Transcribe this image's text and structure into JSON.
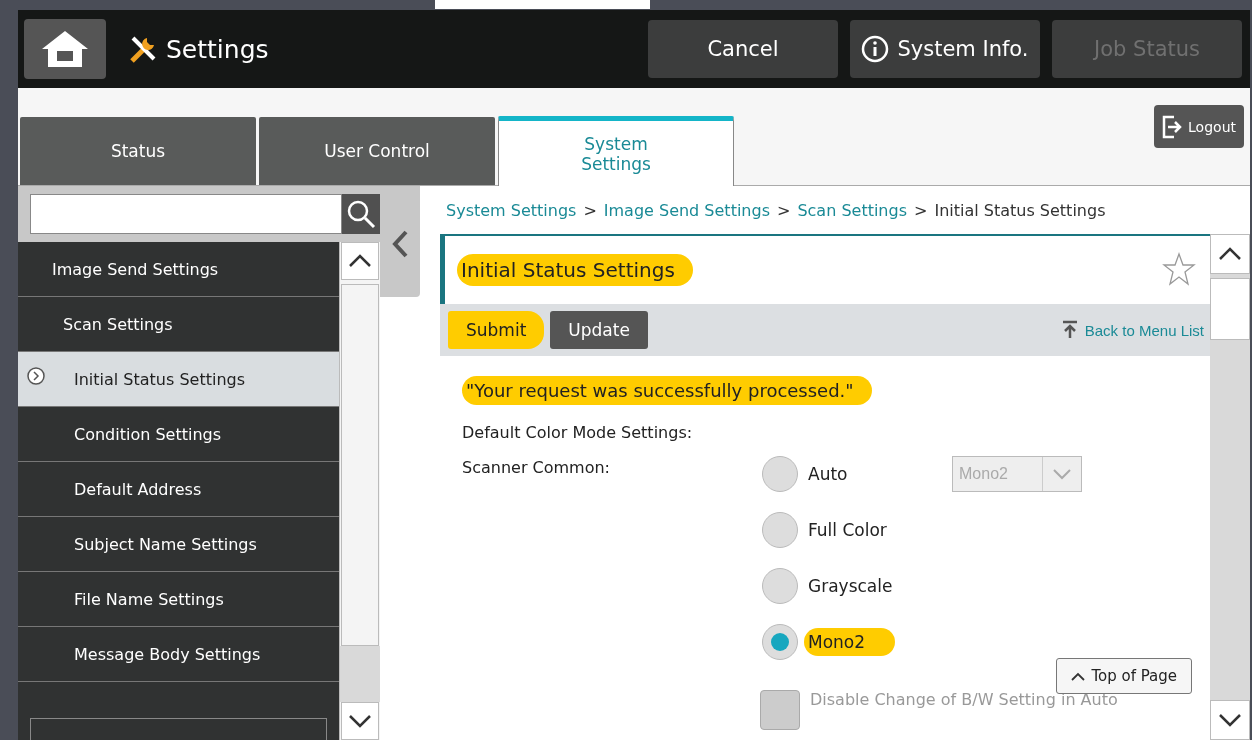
{
  "header": {
    "title": "Settings",
    "buttons": [
      {
        "label": "Cancel",
        "kind": "plain",
        "disabled": false
      },
      {
        "label": "System Info.",
        "kind": "info",
        "disabled": false
      },
      {
        "label": "Job Status",
        "kind": "plain",
        "disabled": true
      }
    ]
  },
  "tabs": [
    {
      "label": "Status",
      "selected": false
    },
    {
      "label": "User Control",
      "selected": false
    },
    {
      "label": "System Settings",
      "selected": true
    }
  ],
  "logout": {
    "label": "Logout"
  },
  "sidebar": {
    "items": [
      {
        "label": "Image Send Settings",
        "selected": false,
        "children": [
          {
            "label": "Scan Settings",
            "selected": false,
            "children": [
              {
                "label": "Initial Status Settings",
                "selected": true
              },
              {
                "label": "Condition Settings",
                "selected": false
              },
              {
                "label": "Default Address",
                "selected": false
              },
              {
                "label": "Subject Name Settings",
                "selected": false
              },
              {
                "label": "File Name Settings",
                "selected": false
              },
              {
                "label": "Message Body Settings",
                "selected": false
              }
            ]
          }
        ]
      }
    ]
  },
  "breadcrumb": [
    {
      "label": "System Settings",
      "link": true,
      "separator": ">"
    },
    {
      "label": "Image Send Settings",
      "link": true,
      "separator": ">"
    },
    {
      "label": "Scan Settings",
      "link": true,
      "separator": ">"
    },
    {
      "label": "Initial Status Settings",
      "link": false
    }
  ],
  "page": {
    "title": "Initial Status Settings",
    "title_highlighted": true,
    "buttons": [
      {
        "label": "Submit",
        "kind": "primary",
        "highlighted": true
      },
      {
        "label": "Update",
        "kind": "secondary",
        "highlighted": false
      }
    ],
    "back_link": "Back to Menu List",
    "message": "\"Your request was successfully processed.\"",
    "message_highlighted": true,
    "section_label": "Default Color Mode Settings:",
    "field_label": "Scanner Common:",
    "options": [
      {
        "label": "Auto",
        "selected": false,
        "highlighted": false
      },
      {
        "label": "Full Color",
        "selected": false,
        "highlighted": false
      },
      {
        "label": "Grayscale",
        "selected": false,
        "highlighted": false
      },
      {
        "label": "Mono2",
        "selected": true,
        "highlighted": true
      }
    ],
    "select": {
      "value": "Mono2",
      "disabled": true
    },
    "checkbox": {
      "label": "Disable Change of B/W Setting in Auto",
      "checked": false,
      "disabled": true
    },
    "top_link": "Top of Page"
  }
}
